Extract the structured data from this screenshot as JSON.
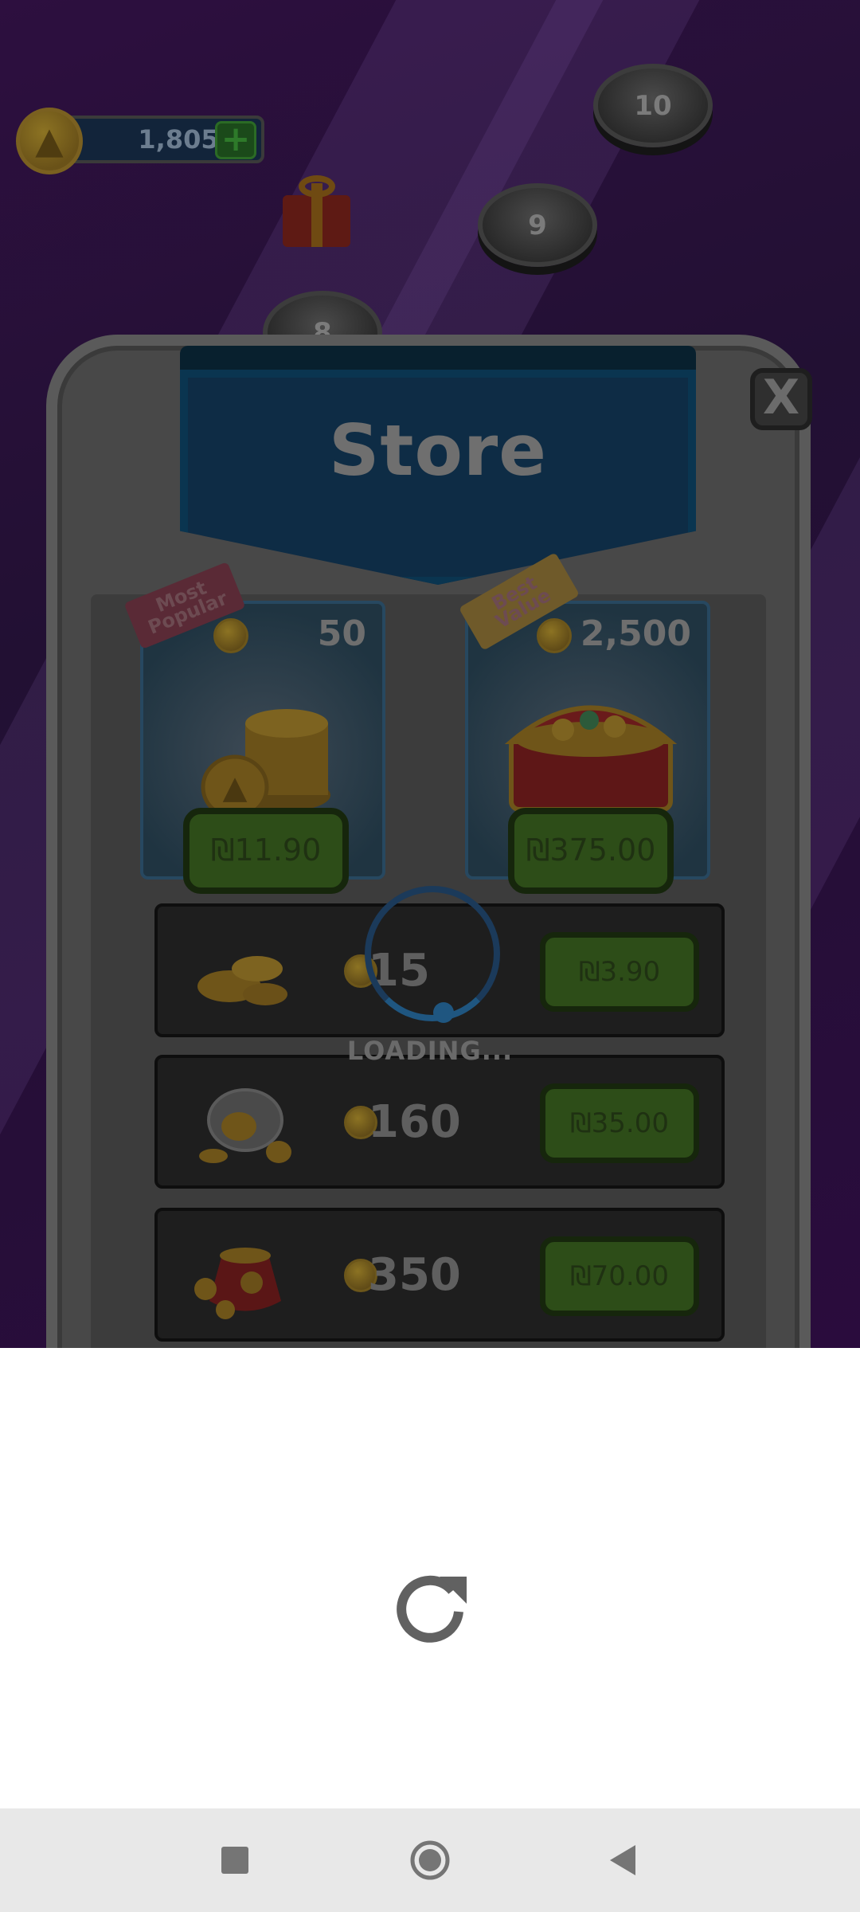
{
  "game": {
    "balance": "1,805",
    "map_nodes": [
      "10",
      "9",
      "8"
    ]
  },
  "store": {
    "title": "Store",
    "close_label": "X",
    "featured": [
      {
        "tag": "Most Popular",
        "amount": "50",
        "price": "₪11.90"
      },
      {
        "tag": "Best Value",
        "amount": "2,500",
        "price": "₪375.00"
      }
    ],
    "packs": [
      {
        "amount": "15",
        "price": "₪3.90"
      },
      {
        "amount": "160",
        "price": "₪35.00"
      },
      {
        "amount": "350",
        "price": "₪70.00"
      }
    ],
    "loading_text": "LOADING..."
  },
  "colors": {
    "overlay_dim": "#000000",
    "button_green": "#2d4d18",
    "banner_blue": "#0e2c45"
  }
}
